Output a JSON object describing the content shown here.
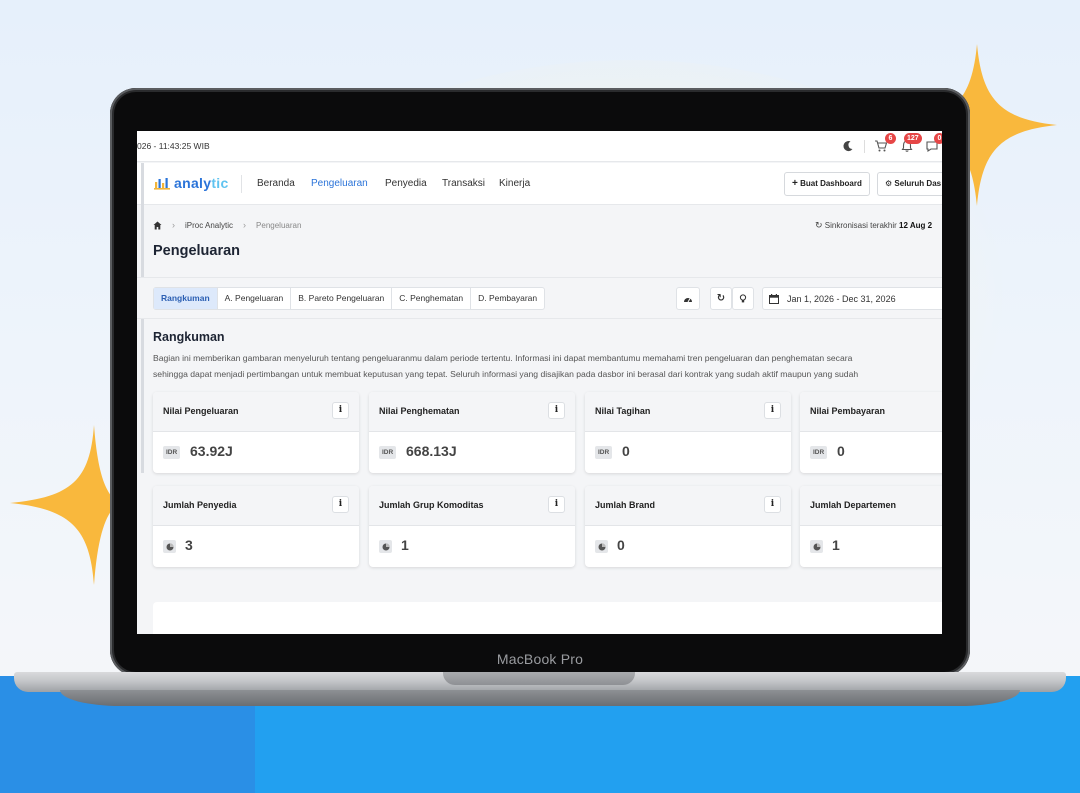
{
  "topbar": {
    "clock": "026 - 11:43:25 WIB",
    "cart_badge": "6",
    "bell_badge": "127",
    "chat_badge": "0"
  },
  "navbar": {
    "logo_main": "analy",
    "logo_accent": "tic",
    "items": [
      "Beranda",
      "Pengeluaran",
      "Penyedia",
      "Transaksi",
      "Kinerja"
    ],
    "active_item": "Pengeluaran",
    "create_dashboard_label": "Buat Dashboard",
    "all_dashboard_label": "Seluruh Das"
  },
  "breadcrumb": {
    "items": [
      "iProc Analytic",
      "Pengeluaran"
    ]
  },
  "sync": {
    "label": "Sinkronisasi terakhir",
    "value": "12 Aug 2"
  },
  "page": {
    "title": "Pengeluaran"
  },
  "tabs": [
    "Rangkuman",
    "A. Pengeluaran",
    "B. Pareto Pengeluaran",
    "C. Penghematan",
    "D. Pembayaran"
  ],
  "date_range": "Jan 1, 2026 - Dec 31, 2026",
  "summary": {
    "title": "Rangkuman",
    "desc_line1": "Bagian ini memberikan gambaran menyeluruh tentang pengeluaranmu dalam periode tertentu. Informasi ini dapat membantumu memahami tren pengeluaran dan penghematan secara",
    "desc_line2": "sehingga dapat menjadi pertimbangan untuk membuat keputusan yang tepat. Seluruh informasi yang disajikan pada dasbor ini berasal dari kontrak yang sudah aktif maupun yang sudah"
  },
  "cards_row1": [
    {
      "label": "Nilai Pengeluaran",
      "currency": "IDR",
      "value": "63.92J"
    },
    {
      "label": "Nilai Penghematan",
      "currency": "IDR",
      "value": "668.13J"
    },
    {
      "label": "Nilai Tagihan",
      "currency": "IDR",
      "value": "0"
    },
    {
      "label": "Nilai Pembayaran",
      "currency": "IDR",
      "value": "0"
    }
  ],
  "cards_row2": [
    {
      "label": "Jumlah Penyedia",
      "value": "3"
    },
    {
      "label": "Jumlah Grup Komoditas",
      "value": "1"
    },
    {
      "label": "Jumlah Brand",
      "value": "0"
    },
    {
      "label": "Jumlah Departemen",
      "value": "1"
    }
  ],
  "info_glyph": "i",
  "device_label": "MacBook Pro",
  "colors": {
    "accent": "#2b74d9",
    "sparkle": "#f9b83d",
    "floor": "#22a0f0",
    "badge": "#e64646"
  },
  "icons": [
    "home-icon",
    "chevron-right-icon",
    "sync-icon",
    "moon-icon",
    "cart-icon",
    "bell-icon",
    "chat-icon",
    "plus-icon",
    "gear-icon",
    "dashboard-icon",
    "refresh-icon",
    "lightbulb-icon",
    "calendar-icon",
    "pie-chart-icon",
    "info-icon"
  ]
}
